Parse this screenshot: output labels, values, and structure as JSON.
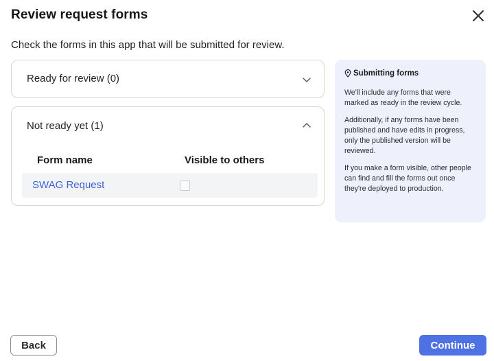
{
  "dialog": {
    "title": "Review request forms",
    "subtitle": "Check the forms in this app that will be submitted for review.",
    "close_icon": "close-icon"
  },
  "sections": {
    "ready": {
      "title": "Ready for review (0)",
      "expanded": false,
      "icon": "chevron-down-icon"
    },
    "not_ready": {
      "title": "Not ready yet (1)",
      "expanded": true,
      "icon": "chevron-up-icon",
      "columns": [
        "Form name",
        "Visible to others"
      ],
      "rows": [
        {
          "form_name": "SWAG Request",
          "visible": false
        }
      ]
    }
  },
  "info": {
    "icon": "location-pin-icon",
    "title": "Submitting forms",
    "paragraphs": [
      "We'll include any forms that were marked as ready in the review cycle.",
      "Additionally, if any forms have been published and have edits in progress, only the published version will be reviewed.",
      "If you make a form visible, other people can find and fill the forms out once they're deployed to production."
    ]
  },
  "footer": {
    "back_label": "Back",
    "continue_label": "Continue"
  },
  "colors": {
    "primary": "#4e71e3",
    "link": "#3a62d6",
    "info_bg": "#eef1fb",
    "border": "#d4d6dc"
  }
}
